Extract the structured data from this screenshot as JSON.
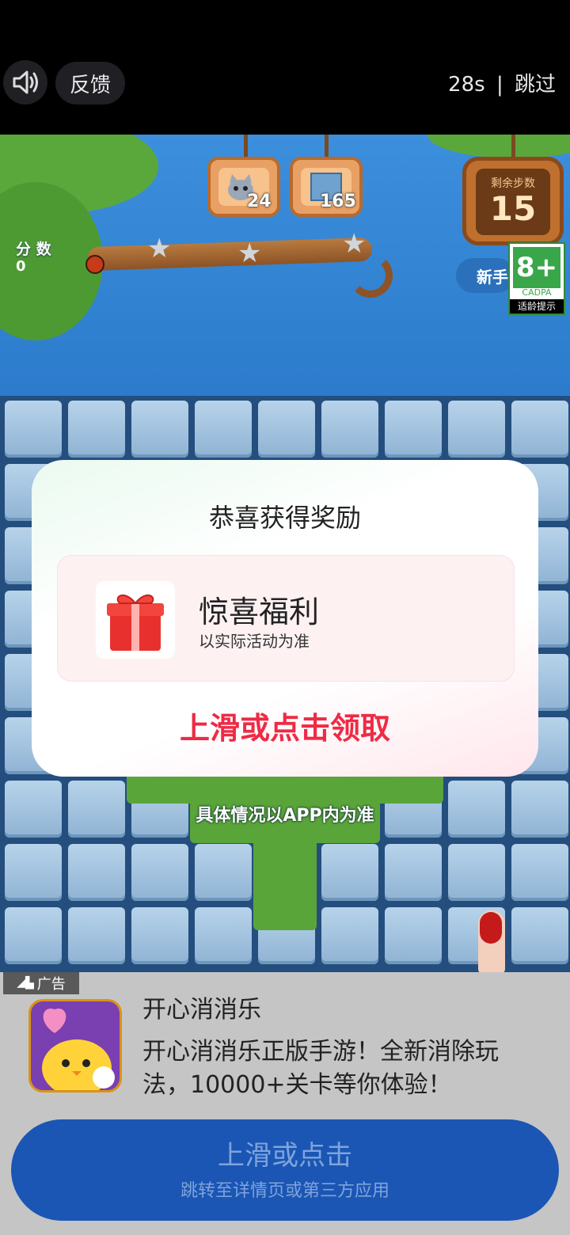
{
  "topbar": {
    "sound_icon": "speaker-icon",
    "feedback_label": "反馈",
    "countdown": "28s",
    "separator": "|",
    "skip_label": "跳过"
  },
  "game": {
    "score_label": "分 数",
    "score_value": "0",
    "goals": [
      {
        "icon": "cat-icon",
        "count": "24"
      },
      {
        "icon": "tile-icon",
        "count": "165"
      }
    ],
    "steps_label": "剩余步数",
    "steps_value": "15",
    "newbie_label": "新手",
    "age_rating": {
      "value": "8+",
      "org": "CADPA",
      "hint": "适龄提示"
    }
  },
  "dialog": {
    "title": "恭喜获得奖励",
    "reward_title": "惊喜福利",
    "reward_subtitle": "以实际活动为准",
    "claim_label": "上滑或点击领取"
  },
  "note": "具体情况以APP内为准",
  "ad": {
    "badge": "广告",
    "app_name": "开心消消乐",
    "description": "开心消消乐正版手游！全新消除玩法，10000+关卡等你体验！",
    "cta_main": "上滑或点击",
    "cta_sub": "跳转至详情页或第三方应用"
  },
  "colors": {
    "claim": "#ee2b45",
    "cta_bg": "#1b56b4"
  }
}
